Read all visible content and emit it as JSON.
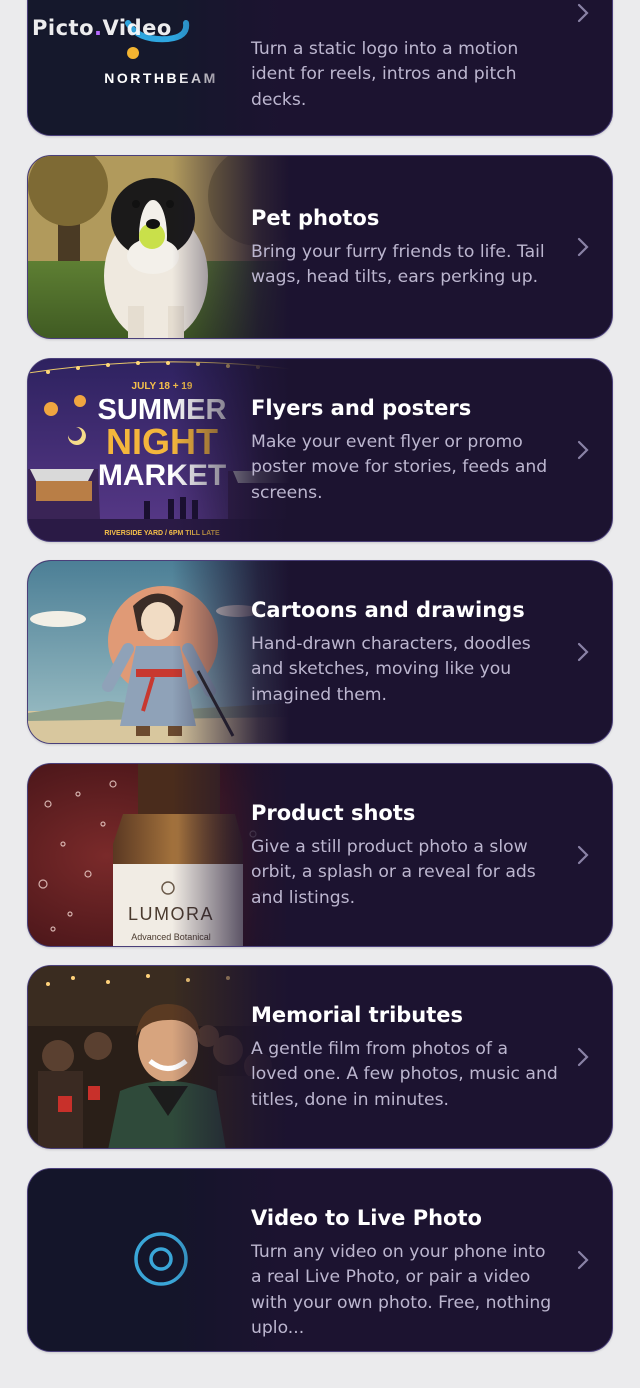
{
  "watermark": {
    "part1": "Picto",
    "dot": ".",
    "part2": "Video"
  },
  "cards": [
    {
      "title": "",
      "description": "Turn a static logo into a motion ident for reels, intros and pitch decks.",
      "thumb_text": "NORTHBEAM",
      "thumb_icon": "northbeam-logo-icon"
    },
    {
      "title": "Pet photos",
      "description": "Bring your furry friends to life. Tail wags, head tilts, ears perking up.",
      "thumb_icon": "dog-photo"
    },
    {
      "title": "Flyers and posters",
      "description": "Make your event flyer or promo poster move for stories, feeds and screens.",
      "thumb_text": {
        "date": "JULY 18 + 19",
        "line1": "SUMMER",
        "line2": "NIGHT",
        "line3": "MARKET",
        "footer": "RIVERSIDE YARD / 6PM TILL LATE"
      }
    },
    {
      "title": "Cartoons and drawings",
      "description": "Hand-drawn characters, doodles and sketches, moving like you imagined them.",
      "thumb_icon": "samurai-drawing"
    },
    {
      "title": "Product shots",
      "description": "Give a still product photo a slow orbit, a splash or a reveal for ads and listings.",
      "thumb_text": {
        "brand": "LUMORA",
        "sub": "Advanced Botanical"
      }
    },
    {
      "title": "Memorial tributes",
      "description": "A gentle film from photos of a loved one. A few photos, music and titles, done in minutes.",
      "thumb_icon": "party-photo"
    },
    {
      "title": "Video to Live Photo",
      "description": "Turn any video on your phone into a real Live Photo, or pair a video with your own photo. Free, nothing uplo...",
      "thumb_icon": "live-photo-icon"
    }
  ],
  "colors": {
    "card_bg": "#1c1330",
    "card_border": "#4a3f7a",
    "accent": "#3aa6d8",
    "page_bg": "#ebebed"
  }
}
